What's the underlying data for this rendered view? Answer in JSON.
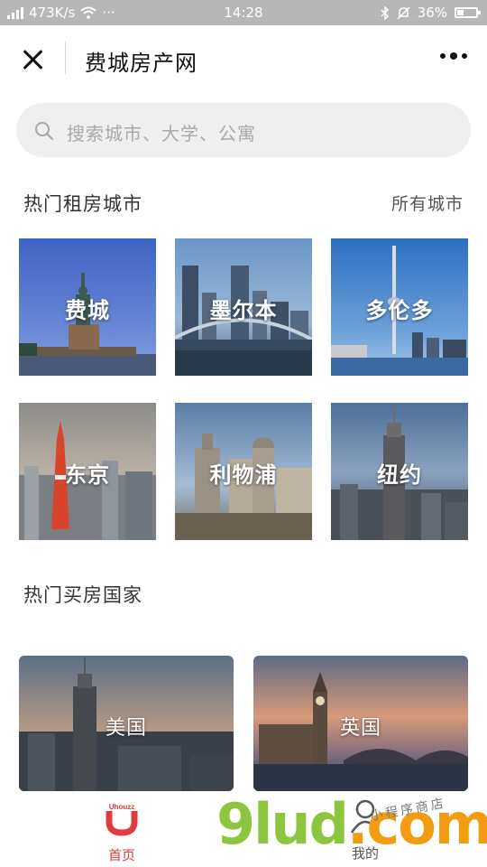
{
  "status_bar": {
    "network_speed": "473K/s",
    "more_dots": "···",
    "time": "14:28",
    "battery": "36%",
    "battery_level": 0.36
  },
  "title_bar": {
    "title": "费城房产网"
  },
  "search": {
    "placeholder": "搜索城市、大学、公寓"
  },
  "rent_section": {
    "title": "热门租房城市",
    "link": "所有城市",
    "cities": [
      {
        "name": "费城",
        "icon": "statue-of-liberty"
      },
      {
        "name": "墨尔本",
        "icon": "melbourne-skyline"
      },
      {
        "name": "多伦多",
        "icon": "cn-tower"
      },
      {
        "name": "东京",
        "icon": "tokyo-tower"
      },
      {
        "name": "利物浦",
        "icon": "liver-building"
      },
      {
        "name": "纽约",
        "icon": "empire-state"
      }
    ]
  },
  "buy_section": {
    "title": "热门买房国家",
    "countries": [
      {
        "name": "美国",
        "icon": "empire-state"
      },
      {
        "name": "英国",
        "icon": "big-ben"
      }
    ]
  },
  "bottom_nav": {
    "home_logo_text": "Uhouzz",
    "home_label": "首页",
    "mine_label": "我的"
  },
  "watermark": {
    "brand": "9lud",
    "suffix": ".com",
    "script_text": "小程序商店"
  },
  "colors": {
    "accent": "#e23b3b",
    "status_bar": "#b7b7b7",
    "search_bg": "#efefef"
  }
}
